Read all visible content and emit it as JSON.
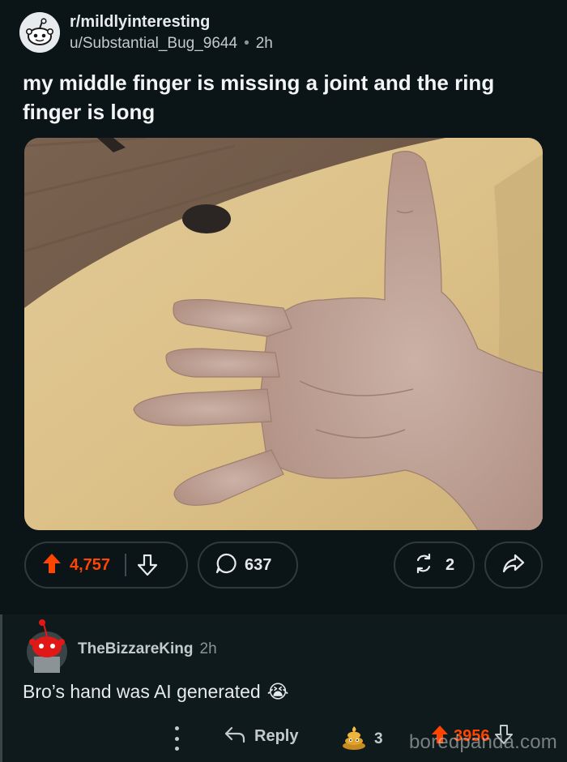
{
  "post": {
    "subreddit": "r/mildlyinteresting",
    "username": "u/Substantial_Bug_9644",
    "separator": "•",
    "age": "2h",
    "title": "my middle finger is missing a joint and the ring finger is long",
    "upvotes": "4,757",
    "comments": "637",
    "crossposts": "2"
  },
  "comment": {
    "username": "TheBizzareKing",
    "age": "2h",
    "text": "Bro’s hand was AI generated",
    "emoji": "😭",
    "reply_label": "Reply",
    "award_count": "3",
    "votes": "3956"
  },
  "watermark": "boredpanda.com",
  "colors": {
    "background": "#0b1416",
    "comment_background": "#0f1a1c",
    "upvote_accent": "#ff4500",
    "pill_border": "#2f3a3d"
  },
  "icons": {
    "subreddit_avatar": "snoo-icon",
    "upvote": "upvote-arrow-icon",
    "downvote": "downvote-arrow-icon",
    "comments": "comment-bubble-icon",
    "crosspost": "crosspost-icon",
    "share": "share-arrow-icon",
    "more": "more-vertical-icon",
    "reply": "reply-arrow-icon",
    "award": "poop-award-icon"
  }
}
